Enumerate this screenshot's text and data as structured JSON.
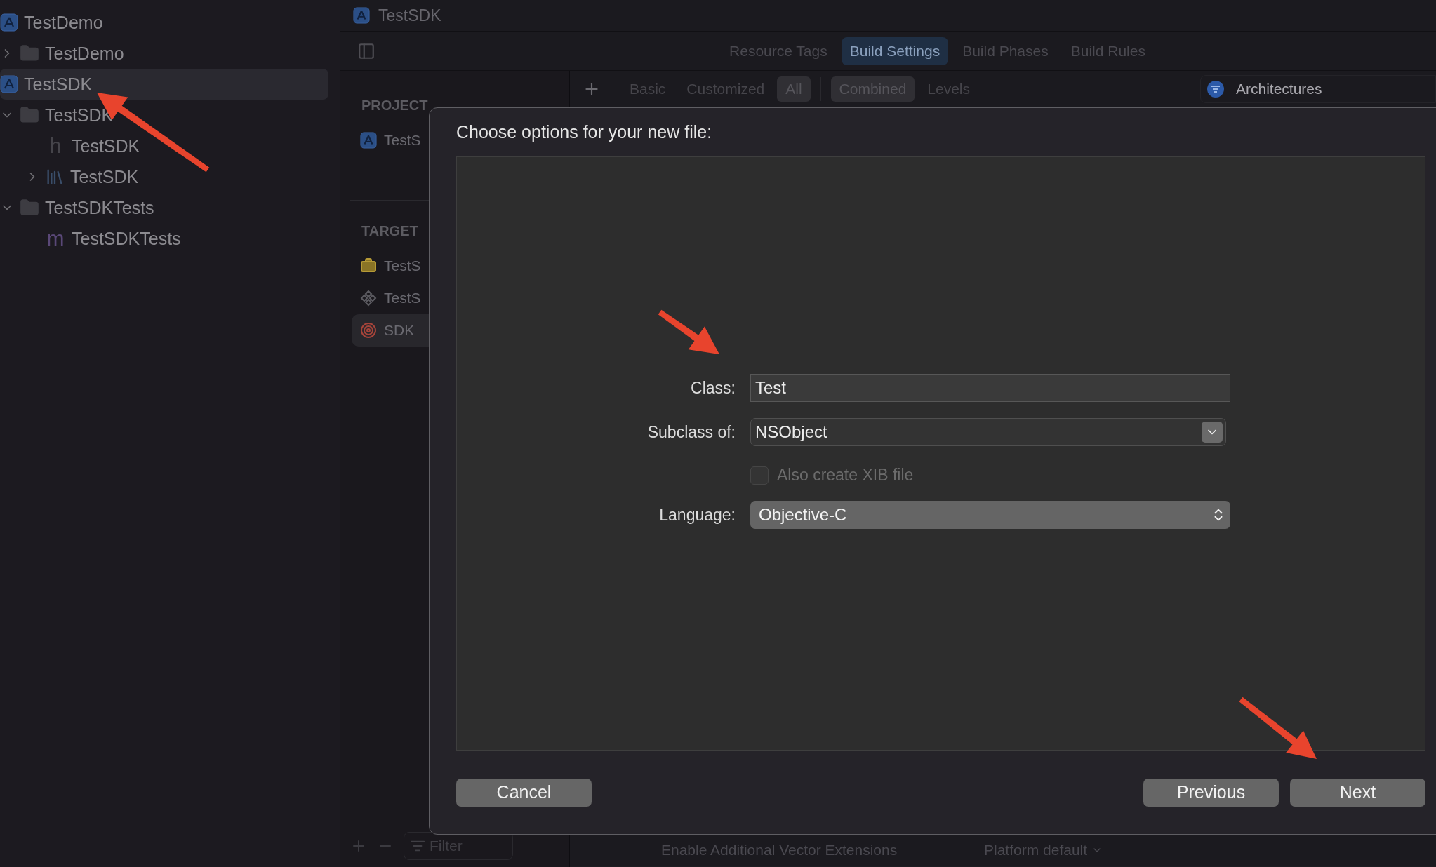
{
  "navigator": {
    "items": [
      {
        "label": "TestDemo",
        "kind": "project",
        "selected": false
      },
      {
        "label": "TestDemo",
        "kind": "folder",
        "expanded": false,
        "selected": false
      },
      {
        "label": "TestSDK",
        "kind": "project",
        "selected": true,
        "children": [
          {
            "label": "TestSDK",
            "kind": "folder",
            "expanded": true,
            "selected": false,
            "children": [
              {
                "label": "TestSDK",
                "kind": "header",
                "badge": "h",
                "selected": false
              },
              {
                "label": "TestSDK",
                "kind": "library",
                "expanded": false,
                "selected": false
              }
            ]
          },
          {
            "label": "TestSDKTests",
            "kind": "folder",
            "expanded": true,
            "selected": false,
            "children": [
              {
                "label": "TestSDKTests",
                "kind": "source",
                "badge": "m",
                "selected": false
              }
            ]
          }
        ]
      }
    ]
  },
  "editor": {
    "breadcrumb": "TestSDK",
    "tabs": [
      {
        "label": "Resource Tags",
        "selected": false
      },
      {
        "label": "Build Settings",
        "selected": true
      },
      {
        "label": "Build Phases",
        "selected": false
      },
      {
        "label": "Build Rules",
        "selected": false
      }
    ],
    "scope_filters": [
      {
        "label": "Basic",
        "selected": false
      },
      {
        "label": "Customized",
        "selected": false
      },
      {
        "label": "All",
        "selected": true
      }
    ],
    "view_filters": [
      {
        "label": "Combined",
        "selected": true
      },
      {
        "label": "Levels",
        "selected": false
      }
    ],
    "search": {
      "value": "Architectures"
    },
    "settings_row": {
      "name": "Enable Additional Vector Extensions",
      "value": "Platform default"
    }
  },
  "targets_panel": {
    "sections": [
      {
        "heading": "PROJECT",
        "items": [
          {
            "label": "TestS",
            "kind": "project",
            "selected": false
          }
        ]
      },
      {
        "heading": "TARGET",
        "items": [
          {
            "label": "TestS",
            "kind": "framework",
            "selected": false
          },
          {
            "label": "TestS",
            "kind": "tests",
            "selected": false
          },
          {
            "label": "SDK",
            "kind": "aggregate",
            "selected": true
          }
        ]
      }
    ],
    "filter": {
      "placeholder": "Filter"
    }
  },
  "dialog": {
    "title": "Choose options for your new file:",
    "fields": [
      {
        "kind": "text",
        "label": "Class:",
        "value": "Test"
      },
      {
        "kind": "combo",
        "label": "Subclass of:",
        "value": "NSObject"
      },
      {
        "kind": "checkbox",
        "label": "Also create XIB file",
        "checked": false,
        "disabled": true
      },
      {
        "kind": "popup",
        "label": "Language:",
        "value": "Objective-C"
      }
    ],
    "buttons": [
      {
        "label": "Cancel"
      },
      {
        "label": "Previous"
      },
      {
        "label": "Next"
      }
    ]
  },
  "annotations": [
    {
      "kind": "arrow"
    },
    {
      "kind": "arrow"
    },
    {
      "kind": "arrow"
    }
  ]
}
